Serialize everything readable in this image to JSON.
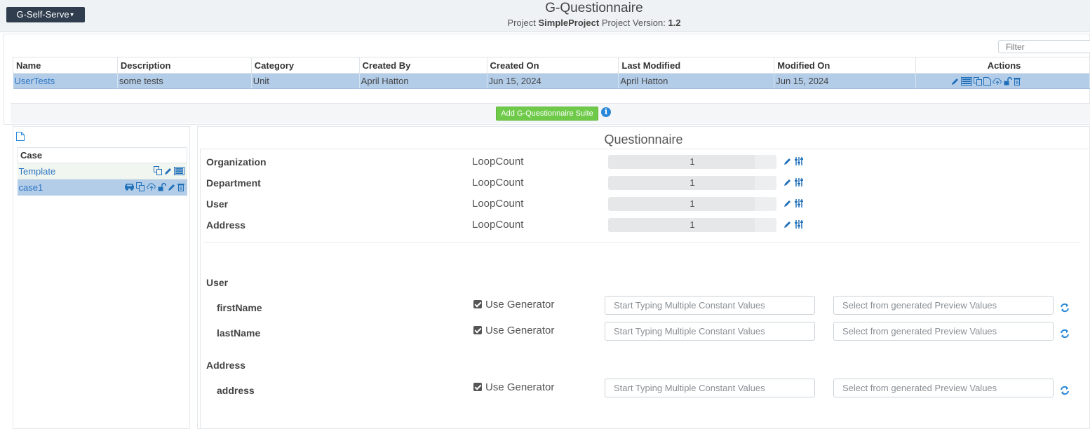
{
  "header": {
    "brand_label": "G-Self-Serve",
    "app_title": "G-Questionnaire",
    "project_prefix": "Project",
    "project_name": "SimpleProject",
    "version_prefix": "Project Version:",
    "version": "1.2"
  },
  "suites": {
    "filter_placeholder": "Filter",
    "columns": [
      "Name",
      "Description",
      "Category",
      "Created By",
      "Created On",
      "Last Modified",
      "Modified On",
      "Actions"
    ],
    "rows": [
      {
        "name": "UserTests",
        "description": "some tests",
        "category": "Unit",
        "created_by": "April Hatton",
        "created_on": "Jun 15, 2024",
        "last_modified": "April Hatton",
        "modified_on": "Jun 15, 2024"
      }
    ],
    "add_button_label": "Add G-Questionnaire Suite"
  },
  "cases": {
    "header": "Case",
    "rows": [
      {
        "label": "Template"
      },
      {
        "label": "case1"
      }
    ]
  },
  "questionnaire": {
    "title": "Questionnaire",
    "loops": [
      {
        "label": "Organization",
        "type": "LoopCount",
        "value": "1"
      },
      {
        "label": "Department",
        "type": "LoopCount",
        "value": "1"
      },
      {
        "label": "User",
        "type": "LoopCount",
        "value": "1"
      },
      {
        "label": "Address",
        "type": "LoopCount",
        "value": "1"
      }
    ],
    "sections": [
      {
        "label": "User",
        "fields": [
          {
            "name": "firstName",
            "generator_label": "Use Generator",
            "use_generator": true,
            "const_placeholder": "Start Typing Multiple Constant Values",
            "preview_placeholder": "Select from generated Preview Values"
          },
          {
            "name": "lastName",
            "generator_label": "Use Generator",
            "use_generator": true,
            "const_placeholder": "Start Typing Multiple Constant Values",
            "preview_placeholder": "Select from generated Preview Values"
          }
        ]
      },
      {
        "label": "Address",
        "fields": [
          {
            "name": "address",
            "generator_label": "Use Generator",
            "use_generator": true,
            "const_placeholder": "Start Typing Multiple Constant Values",
            "preview_placeholder": "Select from generated Preview Values"
          }
        ]
      }
    ]
  },
  "colors": {
    "accent": "#2a88d8",
    "selected_row": "#b3cde9",
    "add_button": "#6fca4a",
    "brand_button": "#2f3d4e"
  },
  "icons": {
    "suite_actions": [
      "pencil-icon",
      "table-icon",
      "copy-icon",
      "file-icon",
      "cloud-upload-icon",
      "unlock-icon",
      "trash-icon"
    ],
    "template_actions": [
      "copy-icon",
      "pencil-icon",
      "table-icon"
    ],
    "case1_actions": [
      "car-icon",
      "copy-icon",
      "cloud-upload-icon",
      "unlock-icon",
      "pencil-icon",
      "trash-icon"
    ],
    "loop_actions": [
      "pencil-icon",
      "sliders-icon"
    ],
    "field_action": "refresh-icon"
  }
}
